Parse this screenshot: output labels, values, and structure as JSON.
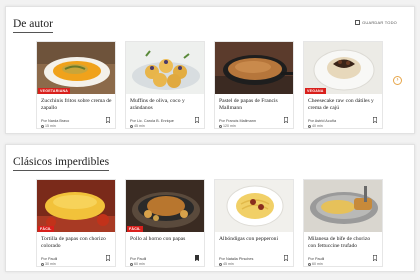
{
  "colors": {
    "accent": "#d9201c",
    "arrow": "#e7a64a"
  },
  "sections": [
    {
      "title": "De autor",
      "see_all": "GUARDAR TODO",
      "next_icon": "›",
      "cards": [
        {
          "tag": "Vegetariana",
          "title": "Zucchinis fritos sobre crema de zapallo",
          "author": "Por Narda Bravo",
          "time": "15 min",
          "saved": false
        },
        {
          "tag": "",
          "title": "Muffins de oliva, coco y arándanos",
          "author": "Por Lic. Carola B. Enrique",
          "time": "45 min",
          "saved": false
        },
        {
          "tag": "",
          "title": "Pastel de papas de Francis Mallmann",
          "author": "Por Francis Mallmann",
          "time": "120 min",
          "saved": false
        },
        {
          "tag": "Vegana",
          "title": "Cheesecake raw con dátiles y crema de cajú",
          "author": "Por Astrid Acuña",
          "time": "40 min",
          "saved": false
        }
      ]
    },
    {
      "title": "Clásicos imperdibles",
      "cards": [
        {
          "tag": "Fácil",
          "title": "Tortilla de papas con chorizo colorado",
          "author": "Por Paulli",
          "time": "30 min",
          "saved": false
        },
        {
          "tag": "Fácil",
          "title": "Pollo al horno con papas",
          "author": "Por Paulli",
          "time": "60 min",
          "saved": true
        },
        {
          "tag": "",
          "title": "Albóndigas con pepperoni",
          "author": "Por Natalia Pirsches",
          "time": "45 min",
          "saved": false
        },
        {
          "tag": "",
          "title": "Milanesa de bife de chorizo con fettuccine trufado",
          "author": "Por Paulli",
          "time": "60 min",
          "saved": false
        }
      ]
    }
  ]
}
